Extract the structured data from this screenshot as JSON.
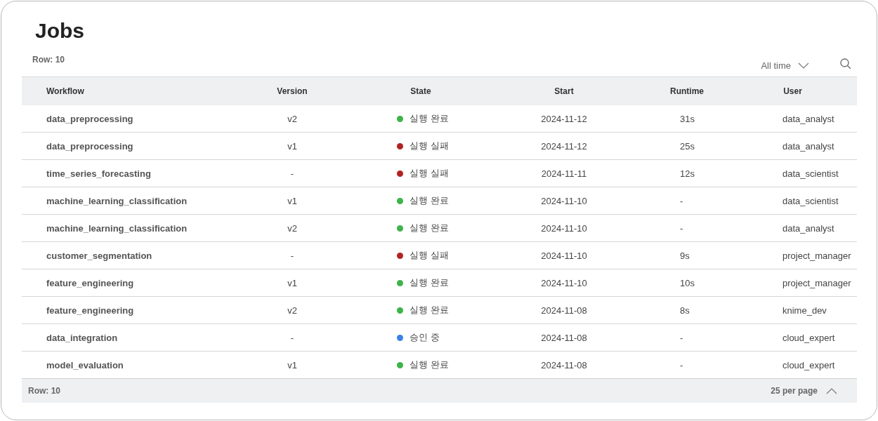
{
  "title": "Jobs",
  "row_count": "Row: 10",
  "time_filter": {
    "value": "All time"
  },
  "table": {
    "columns": [
      "Workflow",
      "Version",
      "State",
      "Start",
      "Runtime",
      "User"
    ],
    "rows": [
      {
        "workflow": "data_preprocessing",
        "version": "v2",
        "state": "실행 완료",
        "color": "#3cb44b",
        "start": "2024-11-12",
        "runtime": "31s",
        "user": "data_analyst"
      },
      {
        "workflow": "data_preprocessing",
        "version": "v1",
        "state": "실행 실패",
        "color": "#b22222",
        "start": "2024-11-12",
        "runtime": "25s",
        "user": "data_analyst"
      },
      {
        "workflow": "time_series_forecasting",
        "version": "-",
        "state": "실행 실패",
        "color": "#b22222",
        "start": "2024-11-11",
        "runtime": "12s",
        "user": "data_scientist"
      },
      {
        "workflow": "machine_learning_classification",
        "version": "v1",
        "state": "실행 완료",
        "color": "#3cb44b",
        "start": "2024-11-10",
        "runtime": "-",
        "user": "data_scientist"
      },
      {
        "workflow": "machine_learning_classification",
        "version": "v2",
        "state": "실행 완료",
        "color": "#3cb44b",
        "start": "2024-11-10",
        "runtime": "-",
        "user": "data_analyst"
      },
      {
        "workflow": "customer_segmentation",
        "version": "-",
        "state": "실행 실패",
        "color": "#b22222",
        "start": "2024-11-10",
        "runtime": "9s",
        "user": "project_manager"
      },
      {
        "workflow": "feature_engineering",
        "version": "v1",
        "state": "실행 완료",
        "color": "#3cb44b",
        "start": "2024-11-10",
        "runtime": "10s",
        "user": "project_manager"
      },
      {
        "workflow": "feature_engineering",
        "version": "v2",
        "state": "실행 완료",
        "color": "#3cb44b",
        "start": "2024-11-08",
        "runtime": "8s",
        "user": "knime_dev"
      },
      {
        "workflow": "data_integration",
        "version": "-",
        "state": "승인 중",
        "color": "#3b82e6",
        "start": "2024-11-08",
        "runtime": "-",
        "user": "cloud_expert"
      },
      {
        "workflow": "model_evaluation",
        "version": "v1",
        "state": "실행 완료",
        "color": "#3cb44b",
        "start": "2024-11-08",
        "runtime": "-",
        "user": "cloud_expert"
      }
    ]
  },
  "footer": {
    "row_count": "Row: 10",
    "page_size": "25 per page"
  }
}
